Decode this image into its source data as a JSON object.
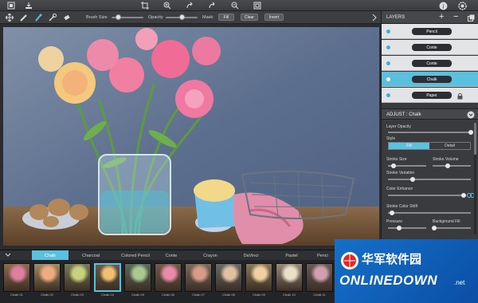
{
  "toolbar": {
    "icons": [
      "app-logo-icon",
      "save-icon",
      "crop-icon",
      "zoom-in-icon",
      "undo-icon",
      "redo-icon",
      "zoom-out-icon",
      "fit-screen-icon",
      "info-icon",
      "settings-icon"
    ]
  },
  "subtoolbar": {
    "brush_size_label": "Brush Size",
    "brush_size_value": 0.2,
    "opacity_label": "Opacity",
    "opacity_value": 0.5,
    "mask_label": "Mask:",
    "fill_button": "Fill",
    "clear_button": "Clear",
    "invert_button": "Invert"
  },
  "layers": {
    "title": "LAYERS",
    "add": "+",
    "remove": "−",
    "items": [
      {
        "label": "Pencil"
      },
      {
        "label": "Conte"
      },
      {
        "label": "Conte"
      },
      {
        "label": "Chalk",
        "selected": true
      },
      {
        "label": "Paper"
      }
    ]
  },
  "adjust": {
    "title": "ADJUST : Chalk",
    "layer_opacity_label": "Layer Opacity",
    "layer_opacity_value": 1.0,
    "style_label": "Style",
    "style_options": [
      "Fill",
      "Detail"
    ],
    "style_selected": "Fill",
    "stroke_size_label": "Stroke Size",
    "stroke_size_value": 0.15,
    "stroke_volume_label": "Stroke Volume",
    "stroke_volume_value": 0.4,
    "stroke_variation_label": "Stroke Variation",
    "stroke_variation_value": 0.3,
    "color_enhance_label": "Color Enhance",
    "color_enhance_value": 0.97,
    "stroke_color_shift_label": "Stroke Color Shift",
    "stroke_color_shift_value": 0.05,
    "pressure_label": "Pressure",
    "pressure_value": 0.3,
    "background_fill_label": "Background Fill",
    "background_fill_value": 0.05
  },
  "presets": {
    "tabs": [
      "Chalk",
      "Charcoal",
      "Colored Pencil",
      "Conte",
      "Crayon",
      "DaVinci",
      "Pastel",
      "Penci"
    ],
    "active_tab": "Chalk",
    "thumbnails": [
      "Chalk 01",
      "Chalk 02",
      "Chalk 03",
      "Chalk 04",
      "Chalk 05",
      "Chalk 06",
      "Chalk 07",
      "Chalk 08",
      "Chalk 09",
      "Chalk 10",
      "Chalk 11"
    ],
    "selected_thumbnail": "Chalk 04"
  },
  "watermark": {
    "cn_text": "华军软件园",
    "en_text": "ONLINEDOWN",
    "suffix": ".net"
  },
  "colors": {
    "accent": "#5bc0dd",
    "panel": "#3a3b3e",
    "toolbar": "#3d3e41",
    "watermark_blue": "#1570c7"
  }
}
